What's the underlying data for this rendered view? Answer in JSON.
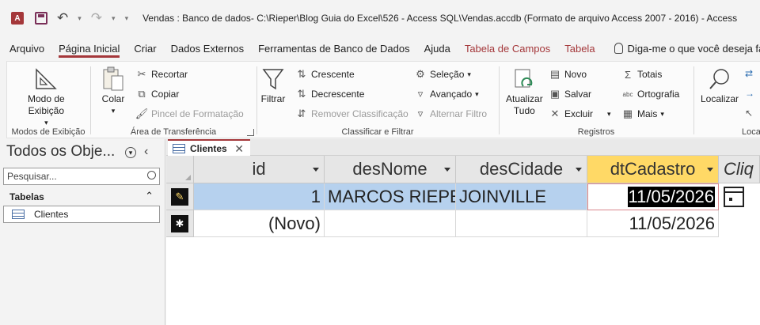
{
  "titlebar": {
    "title": "Vendas : Banco de dados- C:\\Rieper\\Blog Guia do Excel\\526 - Access SQL\\Vendas.accdb (Formato de arquivo Access 2007 - 2016)  -  Access"
  },
  "menu": {
    "tabs": [
      "Arquivo",
      "Página Inicial",
      "Criar",
      "Dados Externos",
      "Ferramentas de Banco de Dados",
      "Ajuda",
      "Tabela de Campos",
      "Tabela"
    ],
    "search_placeholder": "Diga-me o que você deseja fazer"
  },
  "ribbon": {
    "views": {
      "mode_line1": "Modo de",
      "mode_line2": "Exibição",
      "label": "Modos de Exibição"
    },
    "clipboard": {
      "paste": "Colar",
      "cut": "Recortar",
      "copy": "Copiar",
      "format_painter": "Pincel de Formatação",
      "label": "Área de Transferência"
    },
    "sort_filter": {
      "filter": "Filtrar",
      "ascending": "Crescente",
      "descending": "Decrescente",
      "remove_sort": "Remover Classificação",
      "selection": "Seleção",
      "advanced": "Avançado",
      "toggle_filter": "Alternar Filtro",
      "label": "Classificar e Filtrar"
    },
    "records": {
      "refresh_line1": "Atualizar",
      "refresh_line2": "Tudo",
      "new": "Novo",
      "save": "Salvar",
      "delete": "Excluir",
      "totals": "Totais",
      "spelling": "Ortografia",
      "more": "Mais",
      "label": "Registros"
    },
    "find": {
      "find": "Localizar",
      "label": "Local"
    }
  },
  "nav": {
    "header": "Todos os Obje...",
    "search_placeholder": "Pesquisar...",
    "section": "Tabelas",
    "items": [
      "Clientes"
    ]
  },
  "document": {
    "tab": "Clientes",
    "columns": [
      "id",
      "desNome",
      "desCidade",
      "dtCadastro",
      "Cliq"
    ],
    "rows": [
      {
        "id": "1",
        "desNome": "MARCOS RIEPER",
        "desCidade": "JOINVILLE",
        "dtCadastro": "11/05/2026"
      },
      {
        "id": "(Novo)",
        "desNome": "",
        "desCidade": "",
        "dtCadastro": "11/05/2026"
      }
    ]
  }
}
